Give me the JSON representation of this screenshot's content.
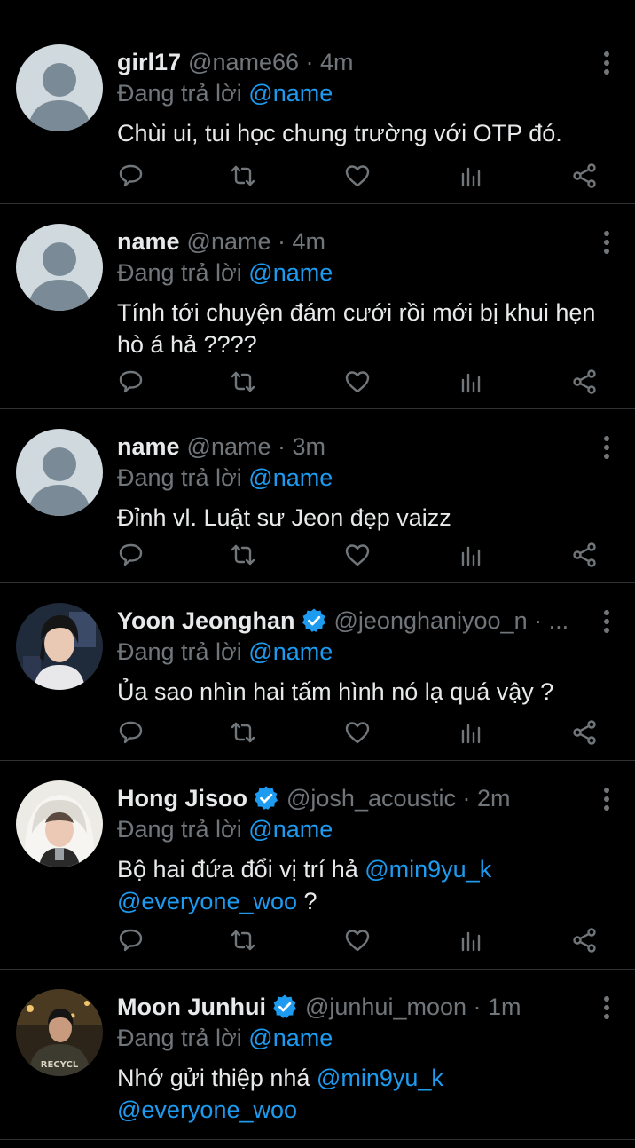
{
  "colors": {
    "background": "#000000",
    "text": "#e7e9ea",
    "muted": "#71767b",
    "accent": "#1d9bf0",
    "divider": "#2f3336"
  },
  "icons": {
    "more": "more-vertical-icon",
    "reply": "reply-icon",
    "retweet": "retweet-icon",
    "like": "heart-icon",
    "views": "views-chart-icon",
    "share": "share-icon",
    "verified": "verified-badge-icon"
  },
  "tweets": [
    {
      "name": "girl17",
      "handle_meta": "@name66 · 4m",
      "reply_prefix": "Đang trả lời",
      "reply_to": "@name",
      "body": [
        {
          "text": "Chùi ui, tui học chung trường với OTP đó."
        }
      ]
    },
    {
      "name": "name",
      "handle_meta": "@name · 4m",
      "reply_prefix": "Đang trả lời",
      "reply_to": "@name",
      "body": [
        {
          "text": "Tính tới chuyện đám cưới rồi mới bị khui hẹn hò á hả ????"
        }
      ]
    },
    {
      "name": "name",
      "handle_meta": "@name · 3m",
      "reply_prefix": "Đang trả lời",
      "reply_to": "@name",
      "body": [
        {
          "text": "Đỉnh vl. Luật sư Jeon đẹp vaizz"
        }
      ]
    },
    {
      "name": "Yoon Jeonghan",
      "verified": true,
      "handle_meta": "@jeonghaniyoo_n · ...",
      "reply_prefix": "Đang trả lời",
      "reply_to": "@name",
      "body": [
        {
          "text": "Ủa sao nhìn hai tấm hình nó lạ quá vậy ?"
        }
      ]
    },
    {
      "name": "Hong Jisoo",
      "verified": true,
      "handle_meta": "@josh_acoustic · 2m",
      "reply_prefix": "Đang trả lời",
      "reply_to": "@name",
      "body": [
        {
          "text": "Bộ hai đứa đổi vị trí hả "
        },
        {
          "text": "@min9yu_k",
          "mention": true
        },
        {
          "text": " "
        },
        {
          "text": "@everyone_woo",
          "mention": true
        },
        {
          "text": " ?"
        }
      ]
    },
    {
      "name": "Moon Junhui",
      "verified": true,
      "handle_meta": "@junhui_moon · 1m",
      "reply_prefix": "Đang trả lời",
      "reply_to": "@name",
      "body": [
        {
          "text": "Nhớ gửi thiệp nhá "
        },
        {
          "text": "@min9yu_k",
          "mention": true
        },
        {
          "text": " "
        },
        {
          "text": "@everyone_woo",
          "mention": true
        }
      ]
    }
  ]
}
